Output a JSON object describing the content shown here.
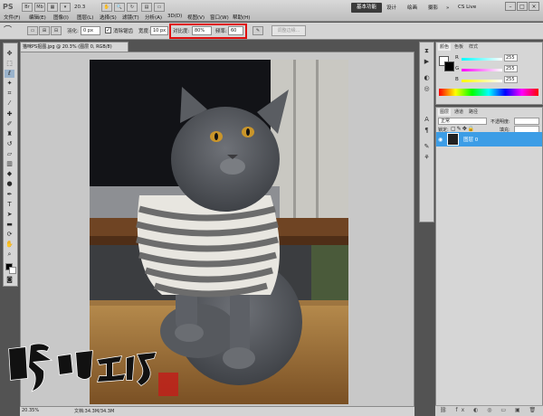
{
  "app": {
    "logo": "PS",
    "zoom": "20.3",
    "workspace_active": "基本功能",
    "workspaces": [
      "设计",
      "绘画",
      "摄影"
    ],
    "cs_live": "CS Live"
  },
  "menu": [
    "文件(F)",
    "编辑(E)",
    "图像(I)",
    "图层(L)",
    "选择(S)",
    "滤镜(T)",
    "分析(A)",
    "3D(D)",
    "视图(V)",
    "窗口(W)",
    "帮助(H)"
  ],
  "options": {
    "feather_label": "羽化:",
    "feather_value": "0 px",
    "antialias_label": "消除锯齿",
    "width_label": "宽度:",
    "width_value": "10 px",
    "contrast_label": "对比度:",
    "contrast_value": "80%",
    "frequency_label": "频率:",
    "frequency_value": "60",
    "refine_edge": "调整边缘..."
  },
  "document": {
    "tab_title": "猫咪PS抠图.jpg @ 20.3% (图层 0, RGB/8)",
    "zoom_status": "20.35%",
    "doc_size": "文档:34.3M/34.3M"
  },
  "watermark": {
    "text": "呼噜工坊"
  },
  "color_panel": {
    "tabs": [
      "颜色",
      "色板",
      "样式"
    ],
    "channels": [
      {
        "label": "R",
        "value": "255"
      },
      {
        "label": "G",
        "value": "255"
      },
      {
        "label": "B",
        "value": "255"
      }
    ]
  },
  "layers_panel": {
    "tabs": [
      "图层",
      "通道",
      "路径"
    ],
    "blend_mode": "正常",
    "opacity_label": "不透明度:",
    "lock_label": "锁定:",
    "fill_label": "填充:",
    "layer_name": "图层 0"
  },
  "colors": {
    "accent": "#3c9de6",
    "highlight_box": "#e01010"
  }
}
